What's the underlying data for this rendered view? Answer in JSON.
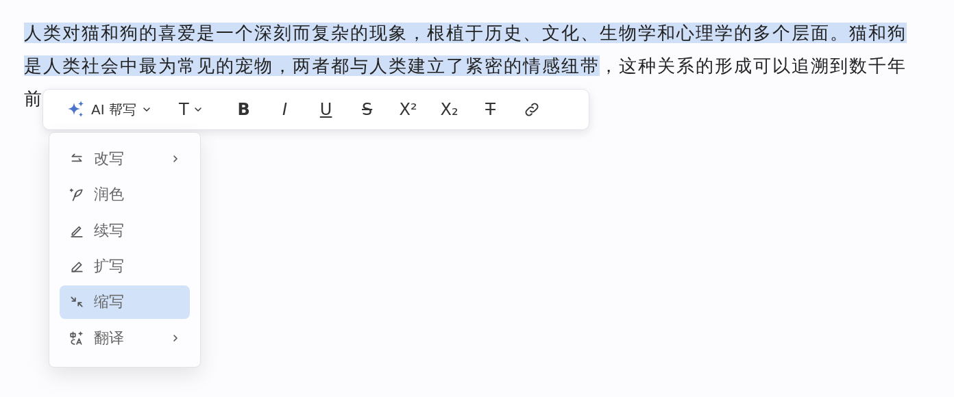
{
  "document": {
    "lines": [
      [
        {
          "text": "人类对猫和狗的喜爱是一个深刻而复杂的现象，根植于历史、文化、生物学和心理学的多个层面。猫和狗",
          "selected": true
        }
      ],
      [
        {
          "text": "是人类社会中最为常见的宠物，两者都与人类建立了紧密的情感纽带",
          "selected": true
        },
        {
          "text": "，这种关系的形成可以追溯到数千年",
          "selected": false
        }
      ],
      [
        {
          "text": "前",
          "selected": false
        }
      ]
    ]
  },
  "toolbar": {
    "ai_button": {
      "label": "AI 帮写"
    },
    "text_style": {
      "label": "T"
    },
    "format_buttons": [
      {
        "kind": "bold",
        "label": "B"
      },
      {
        "kind": "italic",
        "label": "I"
      },
      {
        "kind": "underline",
        "label": "U"
      },
      {
        "kind": "strike",
        "label": "S"
      },
      {
        "kind": "super",
        "label": "X²"
      },
      {
        "kind": "sub",
        "label": "X₂"
      },
      {
        "kind": "clear",
        "label": "T"
      },
      {
        "kind": "link"
      }
    ]
  },
  "ai_menu": [
    {
      "label": "改写",
      "kind": "rewrite",
      "submenu": true,
      "selected": false
    },
    {
      "label": "润色",
      "kind": "polish",
      "submenu": false,
      "selected": false
    },
    {
      "label": "续写",
      "kind": "continue",
      "submenu": false,
      "selected": false
    },
    {
      "label": "扩写",
      "kind": "expand",
      "submenu": false,
      "selected": false
    },
    {
      "label": "缩写",
      "kind": "shorten",
      "submenu": false,
      "selected": true
    },
    {
      "label": "翻译",
      "kind": "translate",
      "submenu": true,
      "selected": false
    }
  ]
}
